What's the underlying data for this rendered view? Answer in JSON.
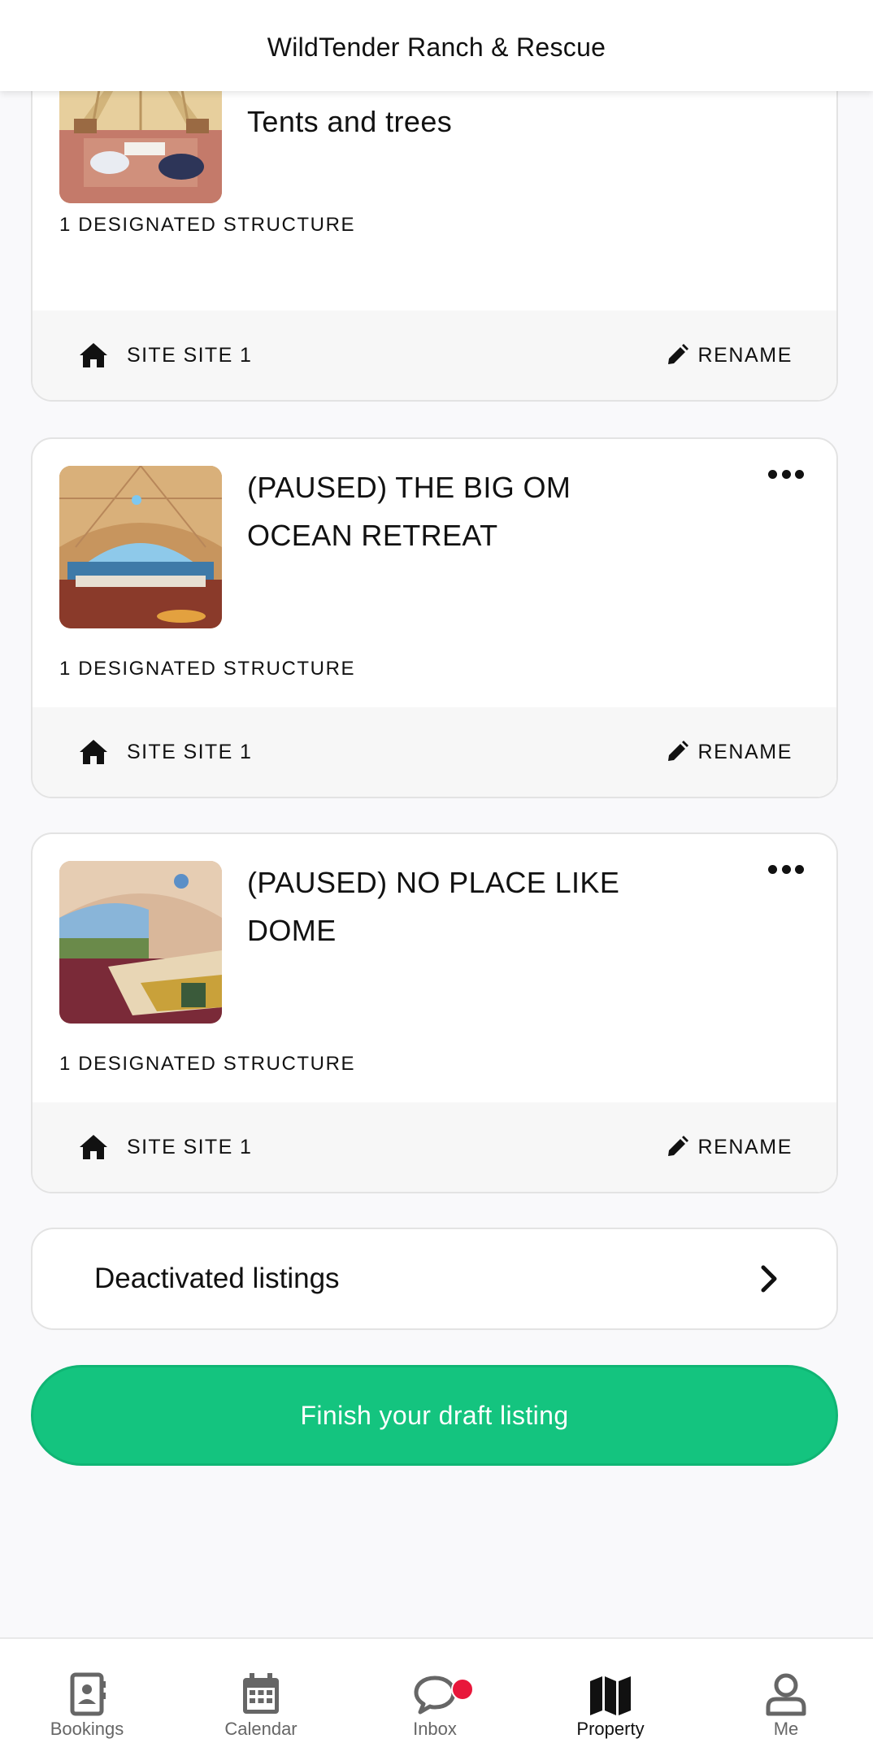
{
  "header": {
    "title": "WildTender Ranch & Rescue"
  },
  "listings": [
    {
      "title": "Tents and trees",
      "structures": "1 DESIGNATED STRUCTURE",
      "site": "SITE SITE 1",
      "rename": "RENAME",
      "image_icon": "teepee-interior-photo"
    },
    {
      "title": "(PAUSED) THE BIG OM OCEAN RETREAT",
      "structures": "1 DESIGNATED STRUCTURE",
      "site": "SITE SITE 1",
      "rename": "RENAME",
      "image_icon": "dome-ocean-view-photo"
    },
    {
      "title": "(PAUSED) NO PLACE LIKE DOME",
      "structures": "1 DESIGNATED STRUCTURE",
      "site": "SITE SITE 1",
      "rename": "RENAME",
      "image_icon": "dome-bedroom-photo"
    }
  ],
  "deactivated": {
    "label": "Deactivated listings"
  },
  "finish": {
    "label": "Finish your draft listing"
  },
  "tabs": [
    {
      "label": "Bookings",
      "icon": "contact-book-icon"
    },
    {
      "label": "Calendar",
      "icon": "calendar-icon"
    },
    {
      "label": "Inbox",
      "icon": "chat-bubble-icon"
    },
    {
      "label": "Property",
      "icon": "map-icon"
    },
    {
      "label": "Me",
      "icon": "person-icon"
    }
  ],
  "colors": {
    "accent": "#14c47f",
    "notification": "#e8173b"
  }
}
